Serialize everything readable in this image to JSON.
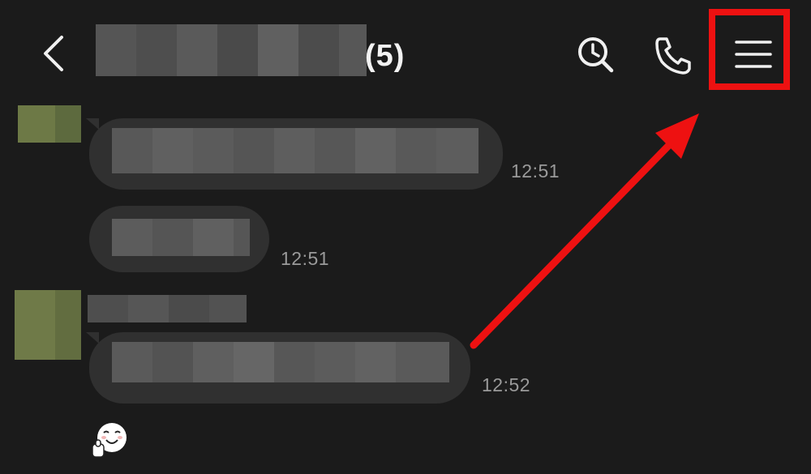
{
  "header": {
    "member_count": "(5)",
    "icons": {
      "back": "back-arrow-icon",
      "search": "search-clock-icon",
      "call": "phone-icon",
      "menu": "hamburger-menu-icon"
    }
  },
  "messages": [
    {
      "time": "12:51"
    },
    {
      "time": "12:51"
    },
    {
      "time": "12:52"
    }
  ],
  "colors": {
    "background": "#1b1b1b",
    "bubble": "#303030",
    "highlight": "#ee1111",
    "timestamp": "#9a9a9a",
    "avatar": "#6b7544"
  }
}
